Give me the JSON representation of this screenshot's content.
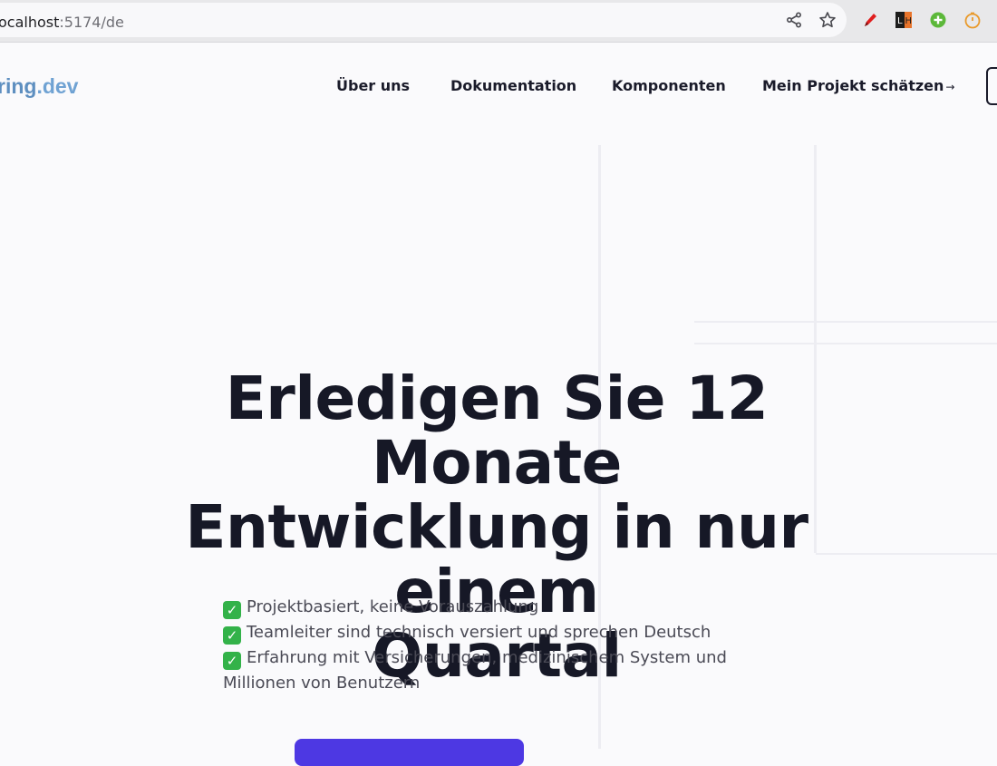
{
  "browser": {
    "url_host": "ocalhost",
    "url_rest": ":5174/de",
    "icons": [
      "share-icon",
      "bookmark-star-icon",
      "pen-extension-icon",
      "lighthouse-extension-icon",
      "add-extension-icon",
      "timer-extension-icon"
    ]
  },
  "site": {
    "logo_main": "ring",
    "logo_suffix": ".dev",
    "nav": {
      "about": "Über uns",
      "docs": "Dokumentation",
      "components": "Komponenten",
      "estimate": "Mein Projekt schätzen",
      "estimate_arrow": "→"
    }
  },
  "hero": {
    "title_line1": "Erledigen Sie 12 Monate",
    "title_line2": "Entwicklung in nur einem",
    "title_line3": "Quartal",
    "bullets": [
      "Projektbasiert, keine Vorauszahlung",
      "Teamleiter sind technisch versiert und sprechen Deutsch",
      "Erfahrung mit Versicherungen, medizinischem System und Millionen von Benutzern"
    ],
    "check_glyph": "✓"
  },
  "colors": {
    "accent": "#4d38e3",
    "logo": "#5e8fc0",
    "text": "#161826",
    "check": "#33b249"
  }
}
